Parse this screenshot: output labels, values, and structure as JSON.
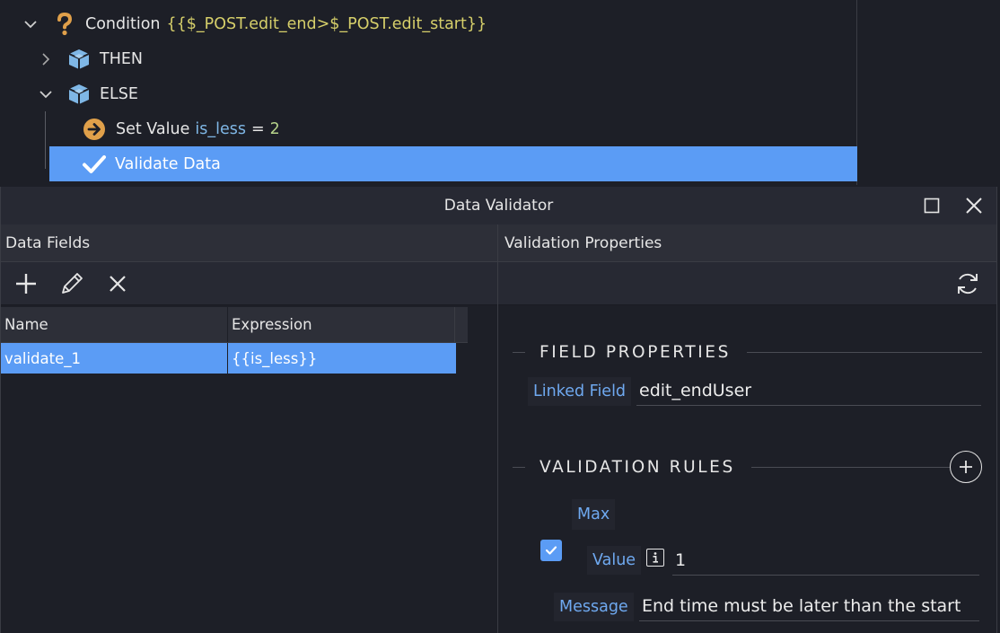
{
  "tree": {
    "condition": {
      "label": "Condition",
      "expression": "{{$_POST.edit_end>$_POST.edit_start}}"
    },
    "then": {
      "label": "THEN"
    },
    "else": {
      "label": "ELSE"
    },
    "set_value": {
      "label": "Set Value",
      "variable": "is_less",
      "equals": "=",
      "value": "2"
    },
    "validate": {
      "label": "Validate Data"
    }
  },
  "dialog": {
    "title": "Data Validator",
    "left_header": "Data Fields",
    "right_header": "Validation Properties",
    "grid": {
      "columns": [
        "Name",
        "Expression"
      ],
      "rows": [
        {
          "name": "validate_1",
          "expression": "{{is_less}}"
        }
      ]
    },
    "field_properties": {
      "title": "FIELD PROPERTIES",
      "linked_field_label": "Linked Field",
      "linked_field_value": "edit_endUser"
    },
    "validation_rules": {
      "title": "VALIDATION RULES",
      "rule_label": "Max",
      "value_label": "Value",
      "value": "1",
      "message_label": "Message",
      "message": "End time must be later than the start"
    }
  },
  "colors": {
    "selection": "#5b9cf5",
    "accent_text": "#6fa9f0",
    "expression_text": "#d6cf6a",
    "icon_orange": "#e0a04a",
    "icon_blue": "#7fb7e6"
  },
  "icons": {
    "condition": "question-mark-icon",
    "then": "cube-icon",
    "else": "cube-icon",
    "set_value": "arrow-circle-icon",
    "validate": "checkmark-icon"
  }
}
